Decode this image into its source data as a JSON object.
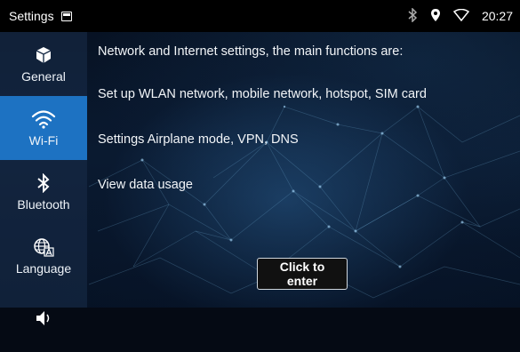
{
  "statusbar": {
    "title": "Settings",
    "time": "20:27",
    "icons": [
      "notification-icon",
      "bluetooth-icon",
      "location-icon",
      "wifi-signal-icon"
    ]
  },
  "sidebar": {
    "items": [
      {
        "label": "General",
        "icon": "box-icon",
        "active": false
      },
      {
        "label": "Wi-Fi",
        "icon": "wifi-icon",
        "active": true
      },
      {
        "label": "Bluetooth",
        "icon": "bluetooth-icon",
        "active": false
      },
      {
        "label": "Language",
        "icon": "language-icon",
        "active": false
      },
      {
        "label": "",
        "icon": "volume-icon",
        "active": false
      }
    ]
  },
  "main": {
    "lines": [
      "Network and Internet settings, the main functions are:",
      "Set up WLAN network, mobile network, hotspot, SIM card",
      "Settings Airplane mode, VPN, DNS",
      "View data usage"
    ],
    "enter_button": "Click to enter"
  },
  "colors": {
    "accent": "#1d72c2",
    "statusbar": "#000000",
    "background": "#0a1a30"
  }
}
